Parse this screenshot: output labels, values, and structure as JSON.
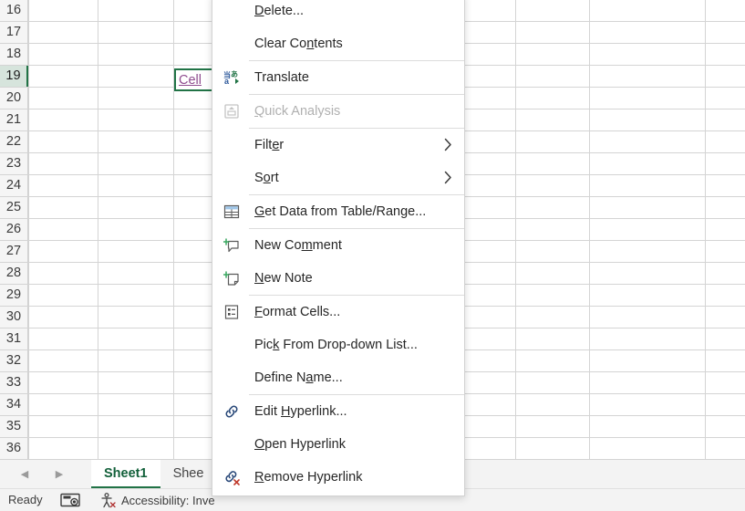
{
  "spreadsheet": {
    "rows": [
      "16",
      "17",
      "18",
      "19",
      "20",
      "21",
      "22",
      "23",
      "24",
      "25",
      "26",
      "27",
      "28",
      "29",
      "30",
      "31",
      "32",
      "33",
      "34",
      "35",
      "36"
    ],
    "selected_row": "19",
    "selected_cell": {
      "text": "Cell",
      "is_hyperlink": true,
      "link_color": "#8f4c8f",
      "selection_border_color": "#217346"
    },
    "grid_line_color": "#d4d4d4",
    "row_header_bg": "#f5f5f5"
  },
  "sheet_tabs": {
    "nav_prev_icon": "chevron-left-icon",
    "nav_next_icon": "chevron-right-icon",
    "tabs": [
      {
        "label": "Sheet1",
        "active": true
      },
      {
        "label": "Shee",
        "active": false
      }
    ],
    "active_color": "#12603a"
  },
  "status_bar": {
    "ready_label": "Ready",
    "macro_record_icon": "macro-record-icon",
    "accessibility_icon": "accessibility-icon",
    "accessibility_label": "Accessibility: Inve"
  },
  "context_menu": {
    "items": [
      {
        "label": "Delete...",
        "accel": "D",
        "icon": null,
        "disabled": false,
        "submenu": false,
        "separator_after": false
      },
      {
        "label": "Clear Contents",
        "accel": "n",
        "icon": null,
        "disabled": false,
        "submenu": false,
        "separator_after": true
      },
      {
        "label": "Translate",
        "accel": null,
        "icon": "translate-icon",
        "disabled": false,
        "submenu": false,
        "separator_after": true
      },
      {
        "label": "Quick Analysis",
        "accel": "Q",
        "icon": "quick-analysis-icon",
        "disabled": true,
        "submenu": false,
        "separator_after": true
      },
      {
        "label": "Filter",
        "accel": "e",
        "icon": null,
        "disabled": false,
        "submenu": true,
        "separator_after": false
      },
      {
        "label": "Sort",
        "accel": "o",
        "icon": null,
        "disabled": false,
        "submenu": true,
        "separator_after": true
      },
      {
        "label": "Get Data from Table/Range...",
        "accel": "G",
        "icon": "get-data-table-icon",
        "disabled": false,
        "submenu": false,
        "separator_after": true
      },
      {
        "label": "New Comment",
        "accel": "m",
        "icon": "new-comment-icon",
        "disabled": false,
        "submenu": false,
        "separator_after": false
      },
      {
        "label": "New Note",
        "accel": "N",
        "icon": "new-note-icon",
        "disabled": false,
        "submenu": false,
        "separator_after": true
      },
      {
        "label": "Format Cells...",
        "accel": "F",
        "icon": "format-cells-icon",
        "disabled": false,
        "submenu": false,
        "separator_after": false
      },
      {
        "label": "Pick From Drop-down List...",
        "accel": "k",
        "icon": null,
        "disabled": false,
        "submenu": false,
        "separator_after": false
      },
      {
        "label": "Define Name...",
        "accel": "a",
        "icon": null,
        "disabled": false,
        "submenu": false,
        "separator_after": true
      },
      {
        "label": "Edit Hyperlink...",
        "accel": "H",
        "icon": "edit-hyperlink-icon",
        "disabled": false,
        "submenu": false,
        "separator_after": false
      },
      {
        "label": "Open Hyperlink",
        "accel": "O",
        "icon": null,
        "disabled": false,
        "submenu": false,
        "separator_after": false
      },
      {
        "label": "Remove Hyperlink",
        "accel": "R",
        "icon": "remove-hyperlink-icon",
        "disabled": false,
        "submenu": false,
        "separator_after": false
      }
    ]
  }
}
